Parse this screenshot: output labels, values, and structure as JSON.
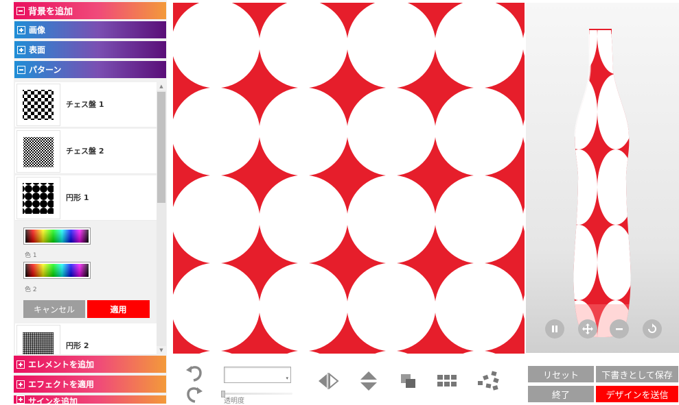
{
  "sidebar": {
    "sections": {
      "background": {
        "label": "背景を追加"
      },
      "image": {
        "label": "画像"
      },
      "surface": {
        "label": "表面"
      },
      "pattern": {
        "label": "パターン"
      },
      "element": {
        "label": "エレメントを追加"
      },
      "effect": {
        "label": "エフェクトを適用"
      },
      "partial": {
        "label": "サインを追加"
      }
    },
    "patterns": [
      {
        "label": "チェス盤 1"
      },
      {
        "label": "チェス盤 2"
      },
      {
        "label": "円形 1"
      },
      {
        "label": "円形 2"
      }
    ],
    "color_pickers": {
      "color1_label": "色 1",
      "color2_label": "色 2"
    },
    "buttons": {
      "cancel": "キャンセル",
      "apply": "適用"
    }
  },
  "colors": {
    "pattern_red": "#e61e2b",
    "apply_red": "#ff0000",
    "grey_button": "#9e9e9e"
  },
  "editor_toolbar": {
    "opacity_label": "透明度",
    "icons": [
      "undo-icon",
      "redo-icon",
      "flip-horizontal-icon",
      "flip-vertical-icon",
      "layer-order-icon",
      "grid-icon",
      "scatter-icon"
    ]
  },
  "preview_controls": {
    "icons": [
      "pause-icon",
      "move-icon",
      "zoom-out-icon",
      "rotate-reset-icon"
    ]
  },
  "actions": {
    "reset": "リセット",
    "save_draft": "下書きとして保存",
    "quit": "終了",
    "send_design": "デザインを送信"
  }
}
